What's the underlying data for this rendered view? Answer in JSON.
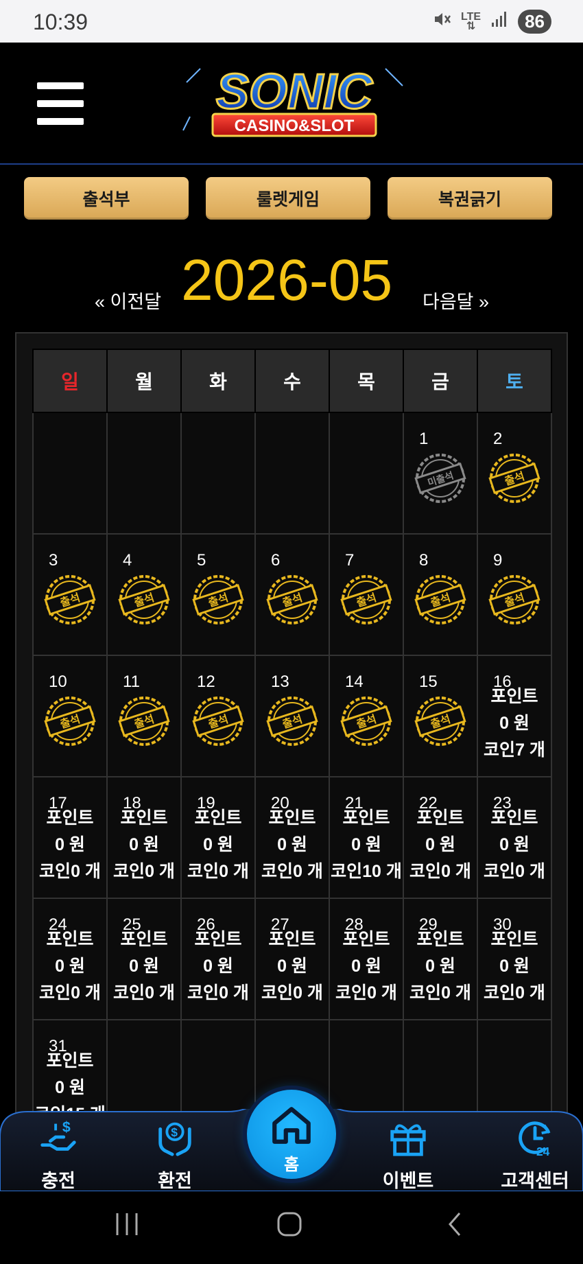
{
  "status": {
    "time": "10:39",
    "network": "LTE",
    "battery": "86"
  },
  "header": {
    "logo_line1": "SONIC",
    "logo_line2": "CASINO&SLOT"
  },
  "top_buttons": [
    {
      "label": "출석부"
    },
    {
      "label": "룰렛게임"
    },
    {
      "label": "복권긁기"
    }
  ],
  "month_nav": {
    "prev": "« 이전달",
    "title": "2026-05",
    "next": "다음달 »"
  },
  "calendar": {
    "weekdays": [
      "일",
      "월",
      "화",
      "수",
      "목",
      "금",
      "토"
    ],
    "stamp_attended": "출석",
    "stamp_absent": "미출석",
    "reward_point_label": "포인트",
    "reward_won_suffix": "원",
    "reward_coin_label": "코인",
    "reward_coin_suffix": "개",
    "days": [
      {
        "day": "1",
        "status": "absent"
      },
      {
        "day": "2",
        "status": "attended"
      },
      {
        "day": "3",
        "status": "attended"
      },
      {
        "day": "4",
        "status": "attended"
      },
      {
        "day": "5",
        "status": "attended"
      },
      {
        "day": "6",
        "status": "attended"
      },
      {
        "day": "7",
        "status": "attended"
      },
      {
        "day": "8",
        "status": "attended"
      },
      {
        "day": "9",
        "status": "attended"
      },
      {
        "day": "10",
        "status": "attended"
      },
      {
        "day": "11",
        "status": "attended"
      },
      {
        "day": "12",
        "status": "attended"
      },
      {
        "day": "13",
        "status": "attended"
      },
      {
        "day": "14",
        "status": "attended"
      },
      {
        "day": "15",
        "status": "attended"
      },
      {
        "day": "16",
        "status": "reward",
        "points": "0",
        "coins": "7"
      },
      {
        "day": "17",
        "status": "reward",
        "points": "0",
        "coins": "0"
      },
      {
        "day": "18",
        "status": "reward",
        "points": "0",
        "coins": "0"
      },
      {
        "day": "19",
        "status": "reward",
        "points": "0",
        "coins": "0"
      },
      {
        "day": "20",
        "status": "reward",
        "points": "0",
        "coins": "0"
      },
      {
        "day": "21",
        "status": "reward",
        "points": "0",
        "coins": "10"
      },
      {
        "day": "22",
        "status": "reward",
        "points": "0",
        "coins": "0"
      },
      {
        "day": "23",
        "status": "reward",
        "points": "0",
        "coins": "0"
      },
      {
        "day": "24",
        "status": "reward",
        "points": "0",
        "coins": "0"
      },
      {
        "day": "25",
        "status": "reward",
        "points": "0",
        "coins": "0"
      },
      {
        "day": "26",
        "status": "reward",
        "points": "0",
        "coins": "0"
      },
      {
        "day": "27",
        "status": "reward",
        "points": "0",
        "coins": "0"
      },
      {
        "day": "28",
        "status": "reward",
        "points": "0",
        "coins": "0"
      },
      {
        "day": "29",
        "status": "reward",
        "points": "0",
        "coins": "0"
      },
      {
        "day": "30",
        "status": "reward",
        "points": "0",
        "coins": "0"
      },
      {
        "day": "31",
        "status": "reward",
        "points": "0",
        "coins": "15"
      }
    ]
  },
  "bottom_nav": [
    {
      "label": "충전",
      "icon": "deposit-icon"
    },
    {
      "label": "환전",
      "icon": "exchange-icon"
    },
    {
      "label": "홈",
      "icon": "home-icon"
    },
    {
      "label": "이벤트",
      "icon": "gift-icon"
    },
    {
      "label": "고객센터",
      "icon": "support-24-icon"
    }
  ],
  "colors": {
    "gold": "#f5c517",
    "button_gold": "#e3b467",
    "accent_blue": "#1aa3f5",
    "sunday": "#e8262b",
    "saturday": "#4fb0f0"
  }
}
